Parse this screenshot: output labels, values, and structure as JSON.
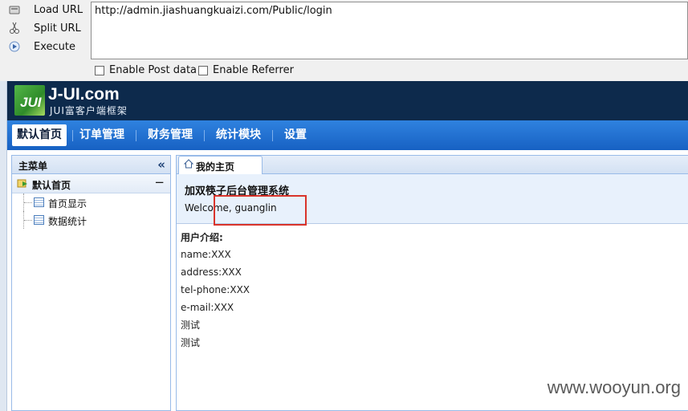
{
  "hackbar": {
    "load_url": "Load URL",
    "split_url": "Split URL",
    "execute": "Execute",
    "url_value": "http://admin.jiashuangkuaizi.com/Public/login",
    "enable_post": "Enable Post data",
    "enable_referrer": "Enable Referrer"
  },
  "header": {
    "logo_mark": "JUI",
    "logo_title": "J-UI.com",
    "logo_subtitle": "JUI富客户端框架"
  },
  "nav": {
    "items": [
      "默认首页",
      "订单管理",
      "财务管理",
      "统计模块",
      "设置"
    ],
    "active": "默认首页"
  },
  "sidebar": {
    "title": "主菜单",
    "section": "默认首页",
    "items": [
      "首页显示",
      "数据统计"
    ]
  },
  "main": {
    "tab_label": "我的主页",
    "system_title": "加双筷子后台管理系统",
    "welcome": "Welcome, guanglin",
    "intro_title": "用户介绍:",
    "intro_lines": [
      "name:XXX",
      "address:XXX",
      "tel-phone:XXX",
      "e-mail:XXX",
      "测试",
      "测试"
    ]
  },
  "watermark": "www.wooyun.org",
  "colors": {
    "header_bg": "#0d2a4c",
    "nav_bg": "#1f6fd1",
    "highlight_border": "#d9342b",
    "panel_bg": "#e8f1fc"
  }
}
